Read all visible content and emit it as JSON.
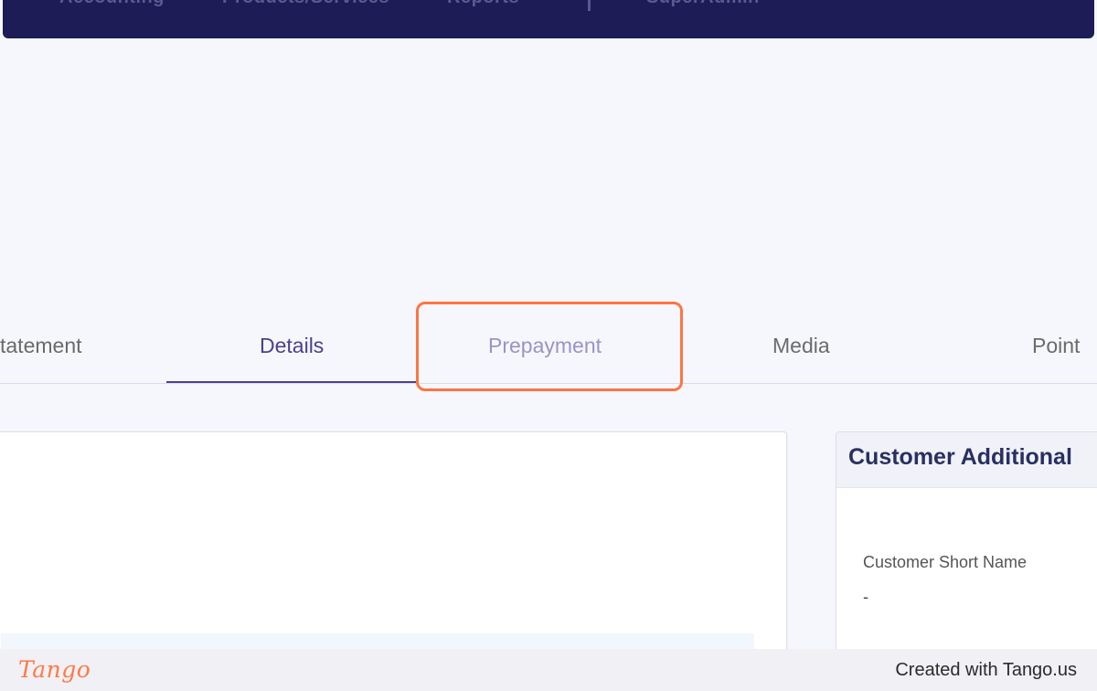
{
  "nav": {
    "items": [
      "Accounting",
      "Products/Services",
      "Reports",
      "SuperAdmin"
    ]
  },
  "tabs": [
    {
      "label": "tatement",
      "state": "default"
    },
    {
      "label": "Details",
      "state": "active"
    },
    {
      "label": "Prepayment",
      "state": "highlighted"
    },
    {
      "label": "Media",
      "state": "default"
    },
    {
      "label": "Point",
      "state": "default"
    }
  ],
  "right_card": {
    "title": "Customer Additional",
    "field_label": "Customer Short Name",
    "field_value": "-"
  },
  "footer": {
    "logo": "Tango",
    "created": "Created with Tango.us"
  },
  "colors": {
    "nav_bg": "#1d1c56",
    "active_tab": "#4c3f8f",
    "highlight": "#ff7443",
    "logo": "#ff7a45"
  }
}
